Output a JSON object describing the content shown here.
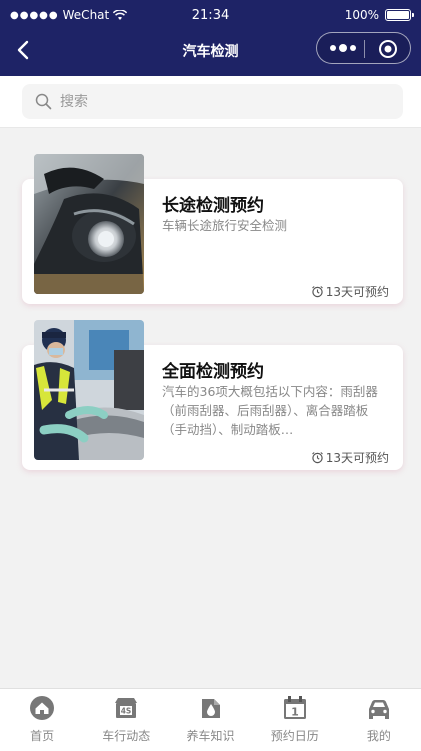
{
  "status_bar": {
    "signal_dots": "●●●●●",
    "carrier": "WeChat",
    "time": "21:34",
    "battery": "100%"
  },
  "nav": {
    "title": "汽车检测"
  },
  "search": {
    "placeholder": "搜索"
  },
  "cards": [
    {
      "title": "长途检测预约",
      "description": "车辆长途旅行安全检测",
      "availability": "13天可预约"
    },
    {
      "title": "全面检测预约",
      "description": "汽车的36项大概包括以下内容：雨刮器（前雨刮器、后雨刮器）、离合器踏板（手动挡）、制动踏板…",
      "availability": "13天可预约"
    }
  ],
  "tabbar": [
    {
      "label": "首页",
      "icon": "home-icon"
    },
    {
      "label": "车行动态",
      "icon": "4s-store-icon"
    },
    {
      "label": "养车知识",
      "icon": "oil-knowledge-icon"
    },
    {
      "label": "预约日历",
      "icon": "calendar-icon",
      "badge": "1"
    },
    {
      "label": "我的",
      "icon": "car-profile-icon"
    }
  ]
}
